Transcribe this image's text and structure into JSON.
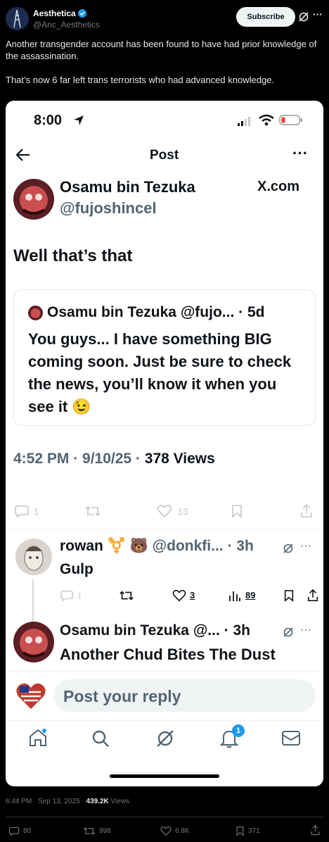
{
  "post": {
    "display_name": "Aesthetica",
    "handle": "@Anc_Aesthetics",
    "subscribe_label": "Subscribe",
    "more_label": "···",
    "text_line1": "Another transgender account has been found to have had prior knowledge of the assassination.",
    "text_line2": "That’s now 6 far left trans terrorists who had advanced knowledge.",
    "timestamp": "6:44 PM · Sep 13, 2025 · ",
    "views_count": "439.2K",
    "views_label": " Views",
    "actions": {
      "replies": "80",
      "reposts": "998",
      "likes": "6.8K",
      "bookmarks": "371"
    }
  },
  "screenshot": {
    "status_time": "8:00",
    "page_title": "Post",
    "more_label": "···",
    "author_name": "Osamu bin Tezuka",
    "author_handle": "@fujoshincel",
    "xcom_label": "X.com",
    "body": "Well that’s that",
    "quote": {
      "header": "Osamu bin Tezuka @fujo... · 5d",
      "text": "You guys... I have something BIG coming soon. Just be sure to check the news, you’ll know it when you see it 😉"
    },
    "meta": "4:52 PM · 9/10/25 · ",
    "meta_views": "378 Views",
    "action_counts": {
      "replies": "1",
      "likes": "13"
    },
    "reply1": {
      "name": "rowan",
      "emoji": "⚧️ 🐻",
      "handle_time": "@donkfi... · 3h",
      "text": "Gulp",
      "replies": "1",
      "likes": "3",
      "views": "89"
    },
    "reply2": {
      "header": "Osamu bin Tezuka @... · 3h",
      "text": "Another Chud Bites The Dust"
    },
    "reply_placeholder": "Post your reply",
    "notification_badge": "1"
  }
}
